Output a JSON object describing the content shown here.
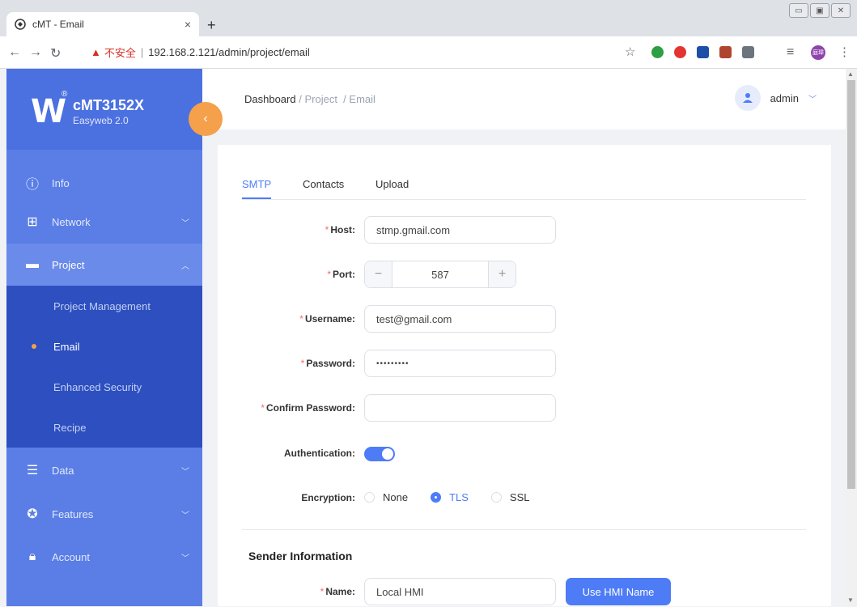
{
  "browser": {
    "tab_title": "cMT - Email",
    "tab_close": "×",
    "new_tab": "+",
    "insecure_label": "不安全",
    "url": "192.168.2.121/admin/project/email",
    "profile_label": "庭瑋",
    "extension_colors": [
      "#2e9e44",
      "#e3342f",
      "#1e4fa8",
      "#b0452f",
      "#6c757d"
    ]
  },
  "sidebar": {
    "brand": "cMT3152X",
    "sub_brand": "Easyweb 2.0",
    "logo_letter": "W",
    "accent": "#f5a04a",
    "items": [
      {
        "label": "Info",
        "icon": "info-icon"
      },
      {
        "label": "Network",
        "icon": "network-icon"
      },
      {
        "label": "Project",
        "icon": "folder-icon"
      },
      {
        "label": "Data",
        "icon": "database-icon"
      },
      {
        "label": "Features",
        "icon": "star-circle-icon"
      },
      {
        "label": "Account",
        "icon": "lock-icon"
      }
    ],
    "project_sub": [
      {
        "label": "Project Management"
      },
      {
        "label": "Email"
      },
      {
        "label": "Enhanced Security"
      },
      {
        "label": "Recipe"
      }
    ]
  },
  "header": {
    "breadcrumb": [
      "Dashboard",
      "Project",
      "Email"
    ],
    "user": "admin"
  },
  "tabs": [
    "SMTP",
    "Contacts",
    "Upload"
  ],
  "form": {
    "host_label": "Host:",
    "host_value": "stmp.gmail.com",
    "port_label": "Port:",
    "port_value": "587",
    "username_label": "Username:",
    "username_value": "test@gmail.com",
    "password_label": "Password:",
    "password_value": "•••••••••",
    "confirm_label": "Confirm Password:",
    "confirm_value": "",
    "auth_label": "Authentication:",
    "auth_enabled": true,
    "encryption_label": "Encryption:",
    "encryption_options": [
      "None",
      "TLS",
      "SSL"
    ],
    "encryption_selected": "TLS"
  },
  "sender": {
    "title": "Sender Information",
    "name_label": "Name:",
    "name_value": "Local HMI",
    "use_hmi_button": "Use HMI Name"
  },
  "colors": {
    "primary": "#4d7cf6",
    "sidebar": "#5a7ee6",
    "sidebar_sub": "#2d4fbf",
    "required": "#f56c6c"
  }
}
